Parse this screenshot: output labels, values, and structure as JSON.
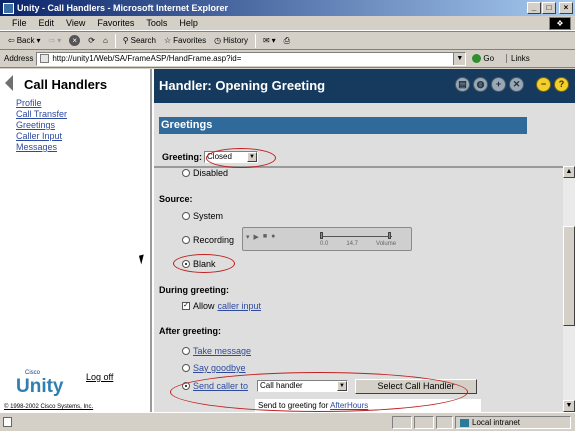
{
  "window": {
    "title": "Unity - Call Handlers - Microsoft Internet Explorer",
    "controls": [
      "_",
      "□",
      "×"
    ]
  },
  "menu": [
    "File",
    "Edit",
    "View",
    "Favorites",
    "Tools",
    "Help"
  ],
  "toolbar": {
    "back": "Back",
    "search": "Search",
    "favorites": "Favorites",
    "history": "History"
  },
  "address": {
    "label": "Address",
    "url": "http://unity1/Web/SA/FrameASP/HandFrame.asp?id=",
    "go": "Go",
    "links": "Links"
  },
  "sidebar": {
    "title": "Call Handlers",
    "links": [
      "Profile",
      "Call Transfer",
      "Greetings",
      "Caller Input",
      "Messages"
    ],
    "brand_small": "Cisco",
    "brand": "Unity",
    "logoff": "Log off",
    "copyright": "© 1998-2002 Cisco Systems, Inc."
  },
  "header": {
    "title": "Handler: Opening Greeting"
  },
  "greetings": {
    "section_title": "Greetings",
    "greeting_label": "Greeting:",
    "greeting_value": "Closed",
    "disabled_label": "Disabled",
    "source_heading": "Source:",
    "source_system": "System",
    "source_recording": "Recording",
    "source_blank": "Blank",
    "media": {
      "left": "0.0",
      "mid": "14.7",
      "vol": "Volume"
    },
    "during_heading": "During greeting:",
    "allow_label": "Allow",
    "caller_input_link": "caller input",
    "after_heading": "After greeting:",
    "take_message": "Take message",
    "say_goodbye": "Say goodbye",
    "send_caller_to": "Send caller to",
    "call_handler_value": "Call handler",
    "select_button": "Select Call Handler",
    "send_to_text": "Send to greeting for",
    "afterhours_link": "AfterHours"
  },
  "status": {
    "zone": "Local intranet"
  },
  "colors": {
    "header_bg": "#163a5e",
    "section_bar": "#2f6a9a",
    "annotation": "#c02020"
  }
}
